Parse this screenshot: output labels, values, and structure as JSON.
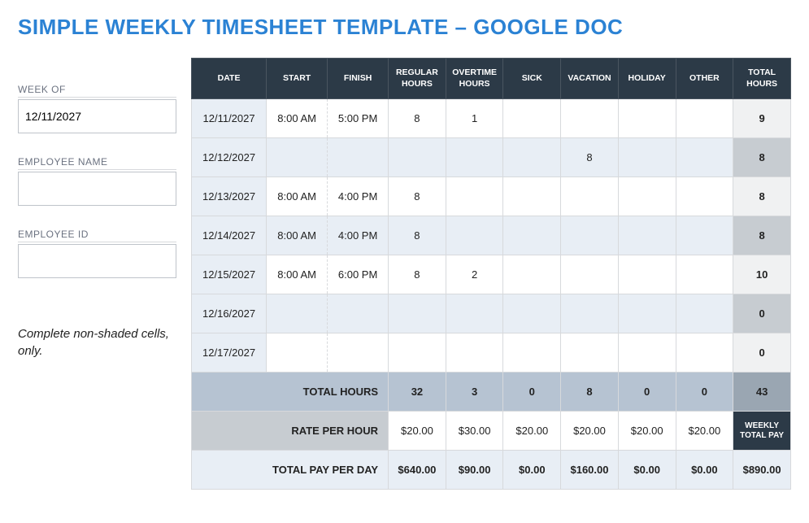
{
  "title": "SIMPLE WEEKLY TIMESHEET TEMPLATE – GOOGLE DOC",
  "sidebar": {
    "week_of_label": "WEEK OF",
    "week_of_value": "12/11/2027",
    "employee_name_label": "EMPLOYEE NAME",
    "employee_name_value": "",
    "employee_id_label": "EMPLOYEE ID",
    "employee_id_value": "",
    "note": "Complete non-shaded cells, only."
  },
  "headers": {
    "date": "DATE",
    "start": "START",
    "finish": "FINISH",
    "regular": "REGULAR HOURS",
    "overtime": "OVERTIME HOURS",
    "sick": "SICK",
    "vacation": "VACATION",
    "holiday": "HOLIDAY",
    "other": "OTHER",
    "total": "TOTAL HOURS"
  },
  "rows": [
    {
      "date": "12/11/2027",
      "start": "8:00 AM",
      "finish": "5:00 PM",
      "regular": "8",
      "overtime": "1",
      "sick": "",
      "vacation": "",
      "holiday": "",
      "other": "",
      "total": "9"
    },
    {
      "date": "12/12/2027",
      "start": "",
      "finish": "",
      "regular": "",
      "overtime": "",
      "sick": "",
      "vacation": "8",
      "holiday": "",
      "other": "",
      "total": "8"
    },
    {
      "date": "12/13/2027",
      "start": "8:00 AM",
      "finish": "4:00 PM",
      "regular": "8",
      "overtime": "",
      "sick": "",
      "vacation": "",
      "holiday": "",
      "other": "",
      "total": "8"
    },
    {
      "date": "12/14/2027",
      "start": "8:00 AM",
      "finish": "4:00 PM",
      "regular": "8",
      "overtime": "",
      "sick": "",
      "vacation": "",
      "holiday": "",
      "other": "",
      "total": "8"
    },
    {
      "date": "12/15/2027",
      "start": "8:00 AM",
      "finish": "6:00 PM",
      "regular": "8",
      "overtime": "2",
      "sick": "",
      "vacation": "",
      "holiday": "",
      "other": "",
      "total": "10"
    },
    {
      "date": "12/16/2027",
      "start": "",
      "finish": "",
      "regular": "",
      "overtime": "",
      "sick": "",
      "vacation": "",
      "holiday": "",
      "other": "",
      "total": "0"
    },
    {
      "date": "12/17/2027",
      "start": "",
      "finish": "",
      "regular": "",
      "overtime": "",
      "sick": "",
      "vacation": "",
      "holiday": "",
      "other": "",
      "total": "0"
    }
  ],
  "summary": {
    "total_hours_label": "TOTAL HOURS",
    "total_hours": {
      "regular": "32",
      "overtime": "3",
      "sick": "0",
      "vacation": "8",
      "holiday": "0",
      "other": "0",
      "total": "43"
    },
    "rate_label": "RATE PER HOUR",
    "rate": {
      "regular": "$20.00",
      "overtime": "$30.00",
      "sick": "$20.00",
      "vacation": "$20.00",
      "holiday": "$20.00",
      "other": "$20.00"
    },
    "weekly_total_pay_label": "WEEKLY TOTAL PAY",
    "total_pay_label": "TOTAL PAY PER DAY",
    "total_pay": {
      "regular": "$640.00",
      "overtime": "$90.00",
      "sick": "$0.00",
      "vacation": "$160.00",
      "holiday": "$0.00",
      "other": "$0.00",
      "total": "$890.00"
    }
  }
}
